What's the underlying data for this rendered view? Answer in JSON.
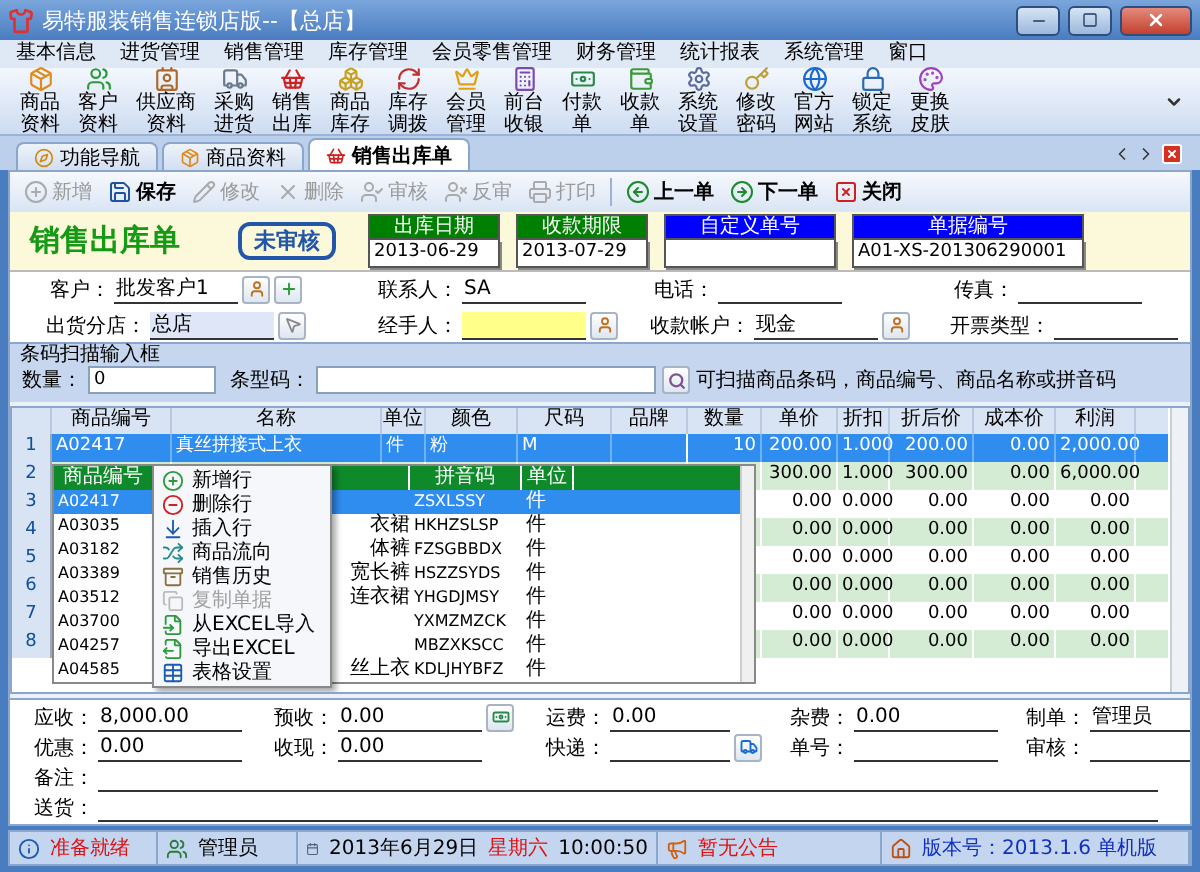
{
  "window": {
    "title": "易特服装销售连锁店版--【总店】"
  },
  "menu": [
    "基本信息",
    "进货管理",
    "销售管理",
    "库存管理",
    "会员零售管理",
    "财务管理",
    "统计报表",
    "系统管理",
    "窗口"
  ],
  "toolbar": [
    "商品资料",
    "客户资料",
    "供应商资料",
    "采购进货",
    "销售出库",
    "商品库存",
    "库存调拨",
    "会员管理",
    "前台收银",
    "付款单",
    "收款单",
    "系统设置",
    "修改密码",
    "官方网站",
    "锁定系统",
    "更换皮肤"
  ],
  "tabs": [
    {
      "label": "功能导航",
      "selected": false
    },
    {
      "label": "商品资料",
      "selected": false
    },
    {
      "label": "销售出库单",
      "selected": true
    }
  ],
  "actions": [
    {
      "label": "新增",
      "disabled": true
    },
    {
      "label": "保存",
      "disabled": false
    },
    {
      "label": "修改",
      "disabled": true
    },
    {
      "label": "删除",
      "disabled": true
    },
    {
      "label": "审核",
      "disabled": true
    },
    {
      "label": "反审",
      "disabled": true
    },
    {
      "label": "打印",
      "disabled": true
    },
    {
      "label": "上一单",
      "disabled": false
    },
    {
      "label": "下一单",
      "disabled": false
    },
    {
      "label": "关闭",
      "disabled": false
    }
  ],
  "document": {
    "title": "销售出库单",
    "status": "未审核",
    "info": [
      {
        "label": "出库日期",
        "value": "2013-06-29",
        "color": "#008000"
      },
      {
        "label": "收款期限",
        "value": "2013-07-29",
        "color": "#008000"
      },
      {
        "label": "自定义单号",
        "color": "#0000ff"
      },
      {
        "label": "单据编号",
        "value": "A01-XS-201306290001",
        "color": "#0000ff"
      }
    ]
  },
  "form": [
    [
      {
        "label": "客户：",
        "value": "批发客户1",
        "kind": "line"
      },
      {
        "label": "联系人：",
        "value": "SA",
        "kind": "line"
      },
      {
        "label": "电话：",
        "kind": "line"
      },
      {
        "label": "传真：",
        "kind": "line"
      }
    ],
    [
      {
        "label": "出货分店：",
        "value": "总店",
        "kind": "locked"
      },
      {
        "label": "经手人：",
        "kind": "required"
      },
      {
        "label": "收款帐户：",
        "value": "现金",
        "kind": "line"
      },
      {
        "label": "开票类型：",
        "kind": "line"
      }
    ]
  ],
  "barcode": {
    "title": "条码扫描输入框",
    "qty_label": "数量：",
    "qty": "0",
    "code_label": "条型码：",
    "hint": "可扫描商品条码，商品编号、商品名称或拼音码"
  },
  "grid": {
    "columns": [
      "商品编号",
      "名称",
      "单位",
      "颜色",
      "尺码",
      "品牌",
      "数量",
      "单价",
      "折扣",
      "折后价",
      "成本价",
      "利润"
    ],
    "rows": [
      {
        "number": "1",
        "selected": true,
        "code": "A02417",
        "name": "真丝拼接式上衣",
        "unit": "件",
        "item_color": "粉",
        "size": "M",
        "qty": "10",
        "price": "200.00",
        "discount": "1.000",
        "net": "200.00",
        "cost": "0.00",
        "profit": "2,000.00"
      },
      {
        "number": "2",
        "selected": false,
        "price": "300.00",
        "discount": "1.000",
        "net": "300.00",
        "cost": "0.00",
        "profit": "6,000.00"
      },
      {
        "number": "3",
        "selected": false,
        "price": "0.00",
        "discount": "0.000",
        "net": "0.00",
        "cost": "0.00",
        "profit": "0.00"
      },
      {
        "number": "4",
        "selected": false,
        "price": "0.00",
        "discount": "0.000",
        "net": "0.00",
        "cost": "0.00",
        "profit": "0.00"
      },
      {
        "number": "5",
        "selected": false,
        "price": "0.00",
        "discount": "0.000",
        "net": "0.00",
        "cost": "0.00",
        "profit": "0.00"
      },
      {
        "number": "6",
        "selected": false,
        "price": "0.00",
        "discount": "0.000",
        "net": "0.00",
        "cost": "0.00",
        "profit": "0.00"
      },
      {
        "number": "7",
        "selected": false,
        "price": "0.00",
        "discount": "0.000",
        "net": "0.00",
        "cost": "0.00",
        "profit": "0.00"
      },
      {
        "number": "8",
        "selected": false,
        "price": "0.00",
        "discount": "0.000",
        "net": "0.00",
        "cost": "0.00",
        "profit": "0.00"
      }
    ]
  },
  "lookup": {
    "headers": {
      "code": "商品编号",
      "pinyin": "拼音码",
      "unit": "单位"
    },
    "rows": [
      {
        "code": "A02417",
        "pinyin": "ZSXLSSY",
        "unit": "件",
        "selected": true
      },
      {
        "code": "A03035",
        "name": "衣裙",
        "pinyin": "HKHZSLSP",
        "unit": "件",
        "selected": false
      },
      {
        "code": "A03182",
        "name": "体裤",
        "pinyin": "FZSGBBDX",
        "unit": "件",
        "selected": false
      },
      {
        "code": "A03389",
        "name": "宽长裤",
        "pinyin": "HSZZSYDS",
        "unit": "件",
        "selected": false
      },
      {
        "code": "A03512",
        "name": "连衣裙",
        "pinyin": "YHGDJMSY",
        "unit": "件",
        "selected": false
      },
      {
        "code": "A03700",
        "pinyin": "YXMZMZCK",
        "unit": "件",
        "selected": false
      },
      {
        "code": "A04257",
        "pinyin": "MBZXKSCC",
        "unit": "件",
        "selected": false
      },
      {
        "code": "A04585",
        "name": "丝上衣",
        "pinyin": "KDLJHYBFZ",
        "unit": "件",
        "selected": false
      }
    ]
  },
  "context_menu": [
    {
      "label": "新增行",
      "disabled": false
    },
    {
      "label": "删除行",
      "disabled": false
    },
    {
      "label": "插入行",
      "disabled": false
    },
    {
      "label": "商品流向",
      "disabled": false
    },
    {
      "label": "销售历史",
      "disabled": false
    },
    {
      "label": "复制单据",
      "disabled": true
    },
    {
      "label": "从EXCEL导入",
      "disabled": false
    },
    {
      "label": "导出EXCEL",
      "disabled": false
    },
    {
      "label": "表格设置",
      "disabled": false
    }
  ],
  "totals": [
    [
      {
        "label": "应收：",
        "value": "8,000.00"
      },
      {
        "label": "预收：",
        "value": "0.00"
      },
      {
        "label": "运费：",
        "value": "0.00"
      },
      {
        "label": "杂费：",
        "value": "0.00"
      },
      {
        "label": "制单：",
        "value": "管理员"
      }
    ],
    [
      {
        "label": "优惠：",
        "value": "0.00"
      },
      {
        "label": "收现：",
        "value": "0.00"
      },
      {
        "label": "快递："
      },
      {
        "label": "单号："
      },
      {
        "label": "审核："
      }
    ]
  ],
  "notes": [
    {
      "label": "备注："
    },
    {
      "label": "送货："
    }
  ],
  "status_bar": [
    {
      "parts": [
        {
          "text": "准备就绪",
          "kind": "alert"
        }
      ]
    },
    {
      "parts": [
        {
          "text": "管理员",
          "kind": "plain"
        }
      ]
    },
    {
      "parts": [
        {
          "text": "2013年6月29日",
          "kind": "plain"
        },
        {
          "text": "星期六",
          "kind": "alert"
        },
        {
          "text": "10:00:50",
          "kind": "plain"
        }
      ]
    },
    {
      "parts": [
        {
          "text": "暂无公告",
          "kind": "alert"
        }
      ]
    },
    {
      "parts": [
        {
          "text": "版本号：2013.1.6 单机版",
          "kind": "info"
        }
      ]
    }
  ]
}
